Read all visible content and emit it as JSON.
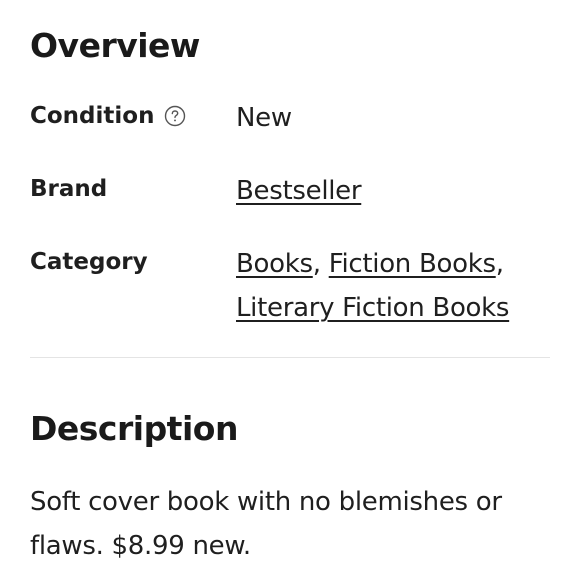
{
  "overview": {
    "title": "Overview",
    "condition": {
      "label": "Condition",
      "value": "New",
      "help_icon": "question-circle-icon"
    },
    "brand": {
      "label": "Brand",
      "value": "Bestseller"
    },
    "category": {
      "label": "Category",
      "links": [
        "Books",
        "Fiction Books",
        "Literary Fiction Books"
      ],
      "separator": ","
    }
  },
  "description": {
    "title": "Description",
    "text": "Soft cover book with no blemishes or flaws. $8.99 new."
  },
  "colors": {
    "text": "#1f1f1f",
    "divider": "#e4e4e4",
    "background": "#ffffff"
  }
}
